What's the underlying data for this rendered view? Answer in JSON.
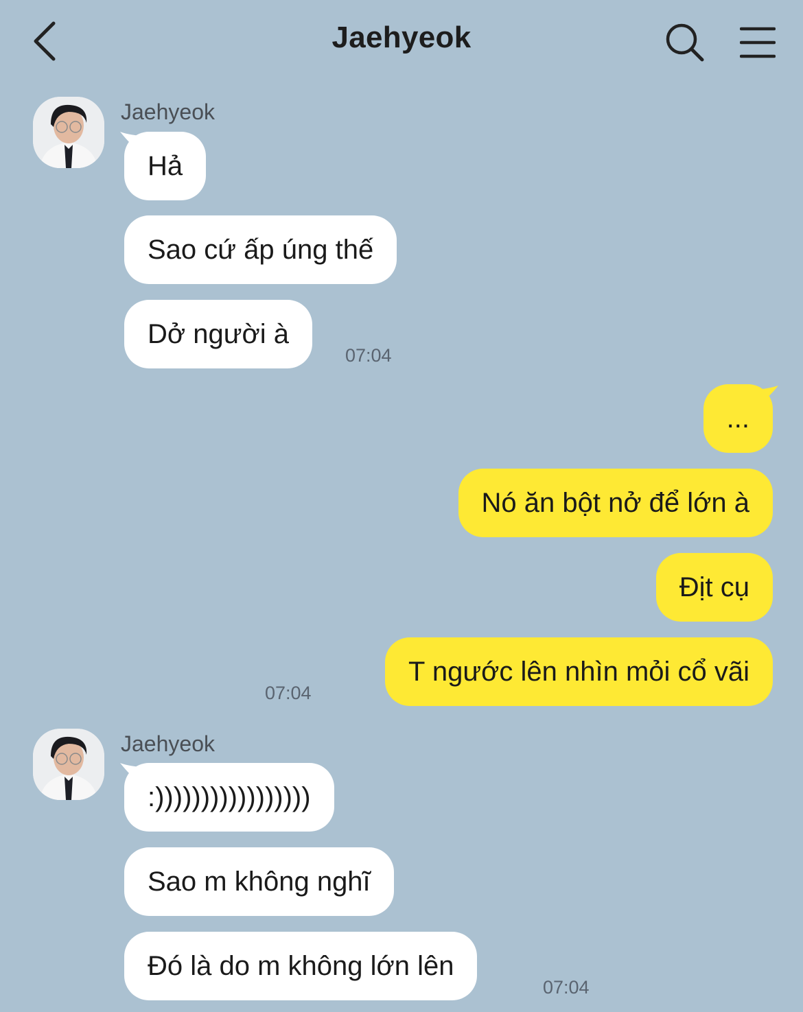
{
  "header": {
    "title": "Jaehyeok",
    "back_icon": "back-chevron-icon",
    "search_icon": "search-icon",
    "menu_icon": "menu-icon"
  },
  "colors": {
    "background": "#abc1d1",
    "incoming_bubble": "#ffffff",
    "outgoing_bubble": "#fee934"
  },
  "messages": {
    "group1": {
      "sender": "Jaehyeok",
      "items": [
        "Hả",
        "Sao cứ ấp úng thế",
        "Dở người à"
      ],
      "time": "07:04"
    },
    "group2": {
      "items": [
        "...",
        "Nó ăn bột nở để lớn à",
        "Địt cụ",
        "T ngước lên nhìn mỏi cổ vãi"
      ],
      "time": "07:04"
    },
    "group3": {
      "sender": "Jaehyeok",
      "items": [
        ":)))))))))))))))))",
        "Sao m không nghĩ",
        "Đó là do m không lớn lên"
      ],
      "time": "07:04"
    }
  }
}
